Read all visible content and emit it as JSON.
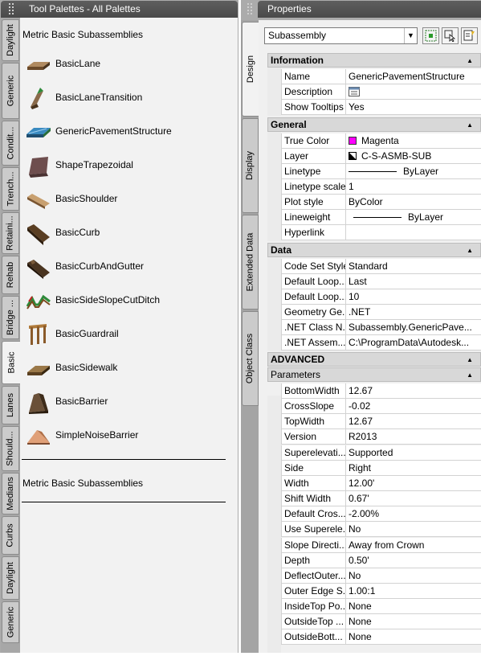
{
  "tool_palette": {
    "title": "Tool Palettes - All Palettes",
    "tabs": [
      "Daylight",
      "Generic",
      "Condit...",
      "Trench...",
      "Retaini...",
      "Rehab",
      "Bridge ...",
      "Basic",
      "Lanes",
      "Should...",
      "Medians",
      "Curbs",
      "Daylight",
      "Generic"
    ],
    "active_tab": "Basic",
    "header": "Metric Basic Subassemblies",
    "tools": [
      {
        "label": "BasicLane",
        "icon": "basic-lane-icon"
      },
      {
        "label": "BasicLaneTransition",
        "icon": "basic-lane-transition-icon"
      },
      {
        "label": "GenericPavementStructure",
        "icon": "generic-pavement-structure-icon"
      },
      {
        "label": "ShapeTrapezoidal",
        "icon": "shape-trapezoidal-icon"
      },
      {
        "label": "BasicShoulder",
        "icon": "basic-shoulder-icon"
      },
      {
        "label": "BasicCurb",
        "icon": "basic-curb-icon"
      },
      {
        "label": "BasicCurbAndGutter",
        "icon": "basic-curb-and-gutter-icon"
      },
      {
        "label": "BasicSideSlopeCutDitch",
        "icon": "basic-side-slope-cut-ditch-icon"
      },
      {
        "label": "BasicGuardrail",
        "icon": "basic-guardrail-icon"
      },
      {
        "label": "BasicSidewalk",
        "icon": "basic-sidewalk-icon"
      },
      {
        "label": "BasicBarrier",
        "icon": "basic-barrier-icon"
      },
      {
        "label": "SimpleNoiseBarrier",
        "icon": "simple-noise-barrier-icon"
      }
    ],
    "footer": "Metric Basic Subassemblies"
  },
  "properties": {
    "title": "Properties",
    "tabs": [
      "Design",
      "Display",
      "Extended Data",
      "Object Class"
    ],
    "active_tab": "Design",
    "selector_value": "Subassembly",
    "categories": {
      "information": {
        "label": "Information",
        "rows": [
          {
            "name": "Name",
            "value": "GenericPavementStructure"
          },
          {
            "name": "Description",
            "value": ""
          },
          {
            "name": "Show Tooltips",
            "value": "Yes"
          }
        ]
      },
      "general": {
        "label": "General",
        "rows": [
          {
            "name": "True Color",
            "value": "Magenta"
          },
          {
            "name": "Layer",
            "value": "C-S-ASMB-SUB"
          },
          {
            "name": "Linetype",
            "value": "ByLayer"
          },
          {
            "name": "Linetype scale",
            "value": "1"
          },
          {
            "name": "Plot style",
            "value": "ByColor"
          },
          {
            "name": "Lineweight",
            "value": "ByLayer"
          },
          {
            "name": "Hyperlink",
            "value": ""
          }
        ]
      },
      "data": {
        "label": "Data",
        "rows": [
          {
            "name": "Code Set Style",
            "value": "Standard"
          },
          {
            "name": "Default Loop...",
            "value": "Last"
          },
          {
            "name": "Default Loop...",
            "value": "10"
          },
          {
            "name": "Geometry Ge...",
            "value": ".NET"
          },
          {
            "name": ".NET Class N...",
            "value": "Subassembly.GenericPave..."
          },
          {
            "name": ".NET Assem...",
            "value": "C:\\ProgramData\\Autodesk..."
          }
        ]
      },
      "advanced": {
        "label": "ADVANCED"
      },
      "parameters": {
        "label": "Parameters",
        "rows": [
          {
            "name": "BottomWidth",
            "value": "12.67"
          },
          {
            "name": "CrossSlope",
            "value": "-0.02"
          },
          {
            "name": "TopWidth",
            "value": "12.67"
          },
          {
            "name": "Version",
            "value": "R2013"
          },
          {
            "name": "Superelevati...",
            "value": "Supported"
          },
          {
            "name": "Side",
            "value": "Right"
          },
          {
            "name": "Width",
            "value": "12.00'"
          },
          {
            "name": "Shift Width",
            "value": "0.67'"
          },
          {
            "name": "Default Cros...",
            "value": "-2.00%"
          },
          {
            "name": "Use Superele...",
            "value": "No"
          },
          {
            "name": "Slope Directi...",
            "value": "Away from Crown"
          },
          {
            "name": "Depth",
            "value": "0.50'"
          },
          {
            "name": "DeflectOuter...",
            "value": "No"
          },
          {
            "name": "Outer Edge S...",
            "value": "1.00:1"
          },
          {
            "name": "InsideTop Po...",
            "value": "None"
          },
          {
            "name": "OutsideTop ...",
            "value": "None"
          },
          {
            "name": "OutsideBott...",
            "value": "None"
          }
        ]
      }
    },
    "colors": {
      "magenta": "#ff00ff"
    }
  }
}
